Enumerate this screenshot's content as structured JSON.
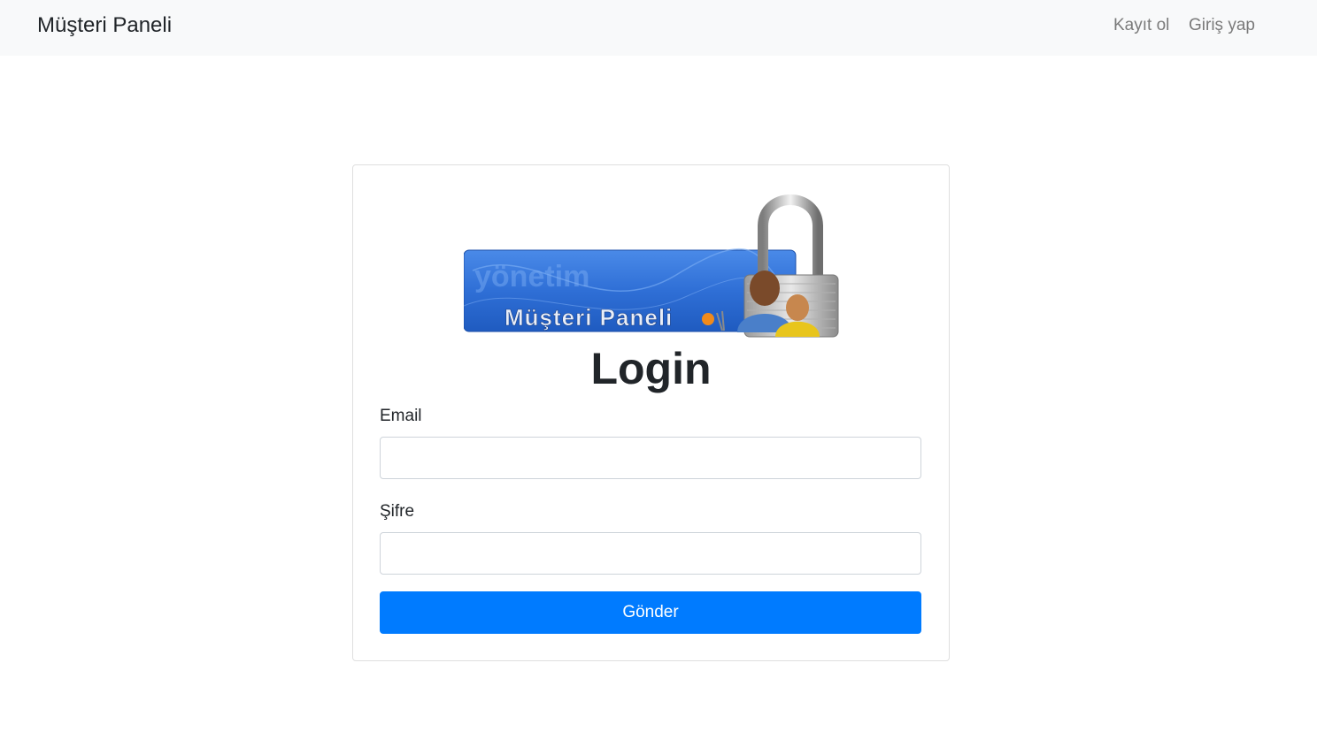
{
  "navbar": {
    "brand": "Müşteri Paneli",
    "links": [
      "Kayıt ol",
      "Giriş yap"
    ]
  },
  "banner": {
    "text": "Müşteri Paneli",
    "watermark": "yönetim",
    "icon": "padlock-users-icon"
  },
  "form": {
    "title": "Login",
    "email_label": "Email",
    "email_value": "",
    "password_label": "Şifre",
    "password_value": "",
    "submit_label": "Gönder"
  },
  "colors": {
    "primary": "#007bff",
    "navbar_bg": "#f8f9fa",
    "nav_link": "#7a7a7a",
    "banner_blue": "#2f6fd6"
  }
}
